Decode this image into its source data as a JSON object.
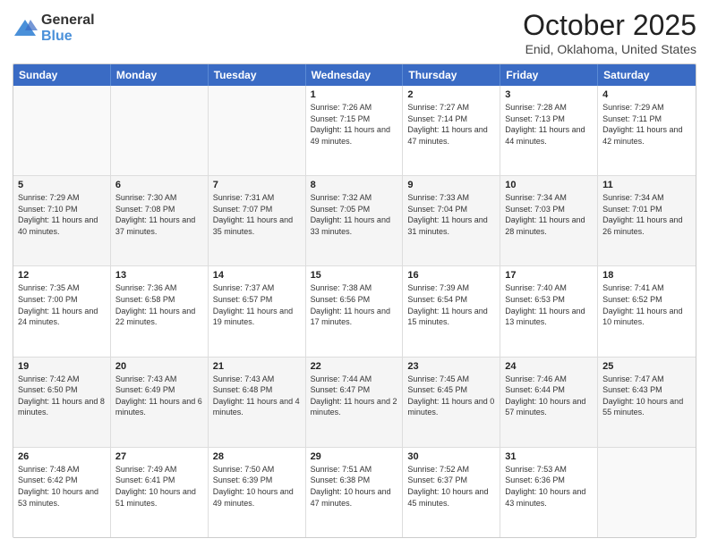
{
  "header": {
    "logo_general": "General",
    "logo_blue": "Blue",
    "title": "October 2025",
    "subtitle": "Enid, Oklahoma, United States"
  },
  "days_of_week": [
    "Sunday",
    "Monday",
    "Tuesday",
    "Wednesday",
    "Thursday",
    "Friday",
    "Saturday"
  ],
  "weeks": [
    [
      {
        "day": "",
        "text": "",
        "empty": true
      },
      {
        "day": "",
        "text": "",
        "empty": true
      },
      {
        "day": "",
        "text": "",
        "empty": true
      },
      {
        "day": "1",
        "text": "Sunrise: 7:26 AM\nSunset: 7:15 PM\nDaylight: 11 hours and 49 minutes."
      },
      {
        "day": "2",
        "text": "Sunrise: 7:27 AM\nSunset: 7:14 PM\nDaylight: 11 hours and 47 minutes."
      },
      {
        "day": "3",
        "text": "Sunrise: 7:28 AM\nSunset: 7:13 PM\nDaylight: 11 hours and 44 minutes."
      },
      {
        "day": "4",
        "text": "Sunrise: 7:29 AM\nSunset: 7:11 PM\nDaylight: 11 hours and 42 minutes."
      }
    ],
    [
      {
        "day": "5",
        "text": "Sunrise: 7:29 AM\nSunset: 7:10 PM\nDaylight: 11 hours and 40 minutes."
      },
      {
        "day": "6",
        "text": "Sunrise: 7:30 AM\nSunset: 7:08 PM\nDaylight: 11 hours and 37 minutes."
      },
      {
        "day": "7",
        "text": "Sunrise: 7:31 AM\nSunset: 7:07 PM\nDaylight: 11 hours and 35 minutes."
      },
      {
        "day": "8",
        "text": "Sunrise: 7:32 AM\nSunset: 7:05 PM\nDaylight: 11 hours and 33 minutes."
      },
      {
        "day": "9",
        "text": "Sunrise: 7:33 AM\nSunset: 7:04 PM\nDaylight: 11 hours and 31 minutes."
      },
      {
        "day": "10",
        "text": "Sunrise: 7:34 AM\nSunset: 7:03 PM\nDaylight: 11 hours and 28 minutes."
      },
      {
        "day": "11",
        "text": "Sunrise: 7:34 AM\nSunset: 7:01 PM\nDaylight: 11 hours and 26 minutes."
      }
    ],
    [
      {
        "day": "12",
        "text": "Sunrise: 7:35 AM\nSunset: 7:00 PM\nDaylight: 11 hours and 24 minutes."
      },
      {
        "day": "13",
        "text": "Sunrise: 7:36 AM\nSunset: 6:58 PM\nDaylight: 11 hours and 22 minutes."
      },
      {
        "day": "14",
        "text": "Sunrise: 7:37 AM\nSunset: 6:57 PM\nDaylight: 11 hours and 19 minutes."
      },
      {
        "day": "15",
        "text": "Sunrise: 7:38 AM\nSunset: 6:56 PM\nDaylight: 11 hours and 17 minutes."
      },
      {
        "day": "16",
        "text": "Sunrise: 7:39 AM\nSunset: 6:54 PM\nDaylight: 11 hours and 15 minutes."
      },
      {
        "day": "17",
        "text": "Sunrise: 7:40 AM\nSunset: 6:53 PM\nDaylight: 11 hours and 13 minutes."
      },
      {
        "day": "18",
        "text": "Sunrise: 7:41 AM\nSunset: 6:52 PM\nDaylight: 11 hours and 10 minutes."
      }
    ],
    [
      {
        "day": "19",
        "text": "Sunrise: 7:42 AM\nSunset: 6:50 PM\nDaylight: 11 hours and 8 minutes."
      },
      {
        "day": "20",
        "text": "Sunrise: 7:43 AM\nSunset: 6:49 PM\nDaylight: 11 hours and 6 minutes."
      },
      {
        "day": "21",
        "text": "Sunrise: 7:43 AM\nSunset: 6:48 PM\nDaylight: 11 hours and 4 minutes."
      },
      {
        "day": "22",
        "text": "Sunrise: 7:44 AM\nSunset: 6:47 PM\nDaylight: 11 hours and 2 minutes."
      },
      {
        "day": "23",
        "text": "Sunrise: 7:45 AM\nSunset: 6:45 PM\nDaylight: 11 hours and 0 minutes."
      },
      {
        "day": "24",
        "text": "Sunrise: 7:46 AM\nSunset: 6:44 PM\nDaylight: 10 hours and 57 minutes."
      },
      {
        "day": "25",
        "text": "Sunrise: 7:47 AM\nSunset: 6:43 PM\nDaylight: 10 hours and 55 minutes."
      }
    ],
    [
      {
        "day": "26",
        "text": "Sunrise: 7:48 AM\nSunset: 6:42 PM\nDaylight: 10 hours and 53 minutes."
      },
      {
        "day": "27",
        "text": "Sunrise: 7:49 AM\nSunset: 6:41 PM\nDaylight: 10 hours and 51 minutes."
      },
      {
        "day": "28",
        "text": "Sunrise: 7:50 AM\nSunset: 6:39 PM\nDaylight: 10 hours and 49 minutes."
      },
      {
        "day": "29",
        "text": "Sunrise: 7:51 AM\nSunset: 6:38 PM\nDaylight: 10 hours and 47 minutes."
      },
      {
        "day": "30",
        "text": "Sunrise: 7:52 AM\nSunset: 6:37 PM\nDaylight: 10 hours and 45 minutes."
      },
      {
        "day": "31",
        "text": "Sunrise: 7:53 AM\nSunset: 6:36 PM\nDaylight: 10 hours and 43 minutes."
      },
      {
        "day": "",
        "text": "",
        "empty": true
      }
    ]
  ]
}
